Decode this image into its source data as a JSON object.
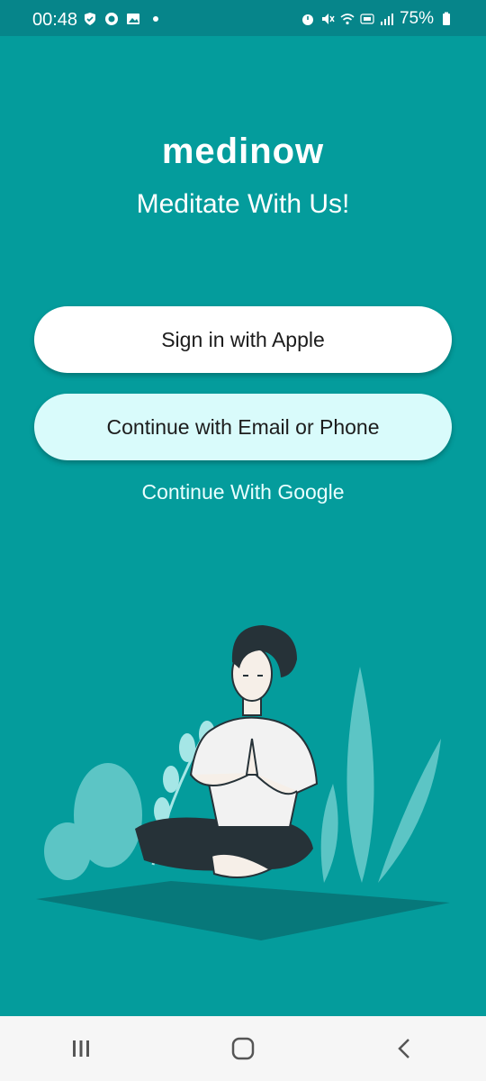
{
  "status_bar": {
    "time": "00:48",
    "battery": "75%",
    "left_icons": [
      "shield-check-icon",
      "badge-icon",
      "image-icon",
      "notification-dot-icon"
    ],
    "right_icons": [
      "alarm-icon",
      "mute-icon",
      "wifi-icon",
      "volte-lte-icon",
      "signal-icon",
      "battery-icon"
    ]
  },
  "app": {
    "logo": "medinow",
    "tagline": "Meditate With Us!"
  },
  "buttons": {
    "apple": "Sign in with Apple",
    "email": "Continue with Email or Phone",
    "google": "Continue With Google"
  },
  "colors": {
    "background": "#049c9c",
    "status_bar": "#06858a",
    "apple_button": "#ffffff",
    "email_button": "#d9fbfb",
    "nav_bar": "#f6f6f6"
  },
  "illustration": "meditating-person-illustration",
  "nav_bar": [
    "recent-apps-icon",
    "home-icon",
    "back-icon"
  ]
}
